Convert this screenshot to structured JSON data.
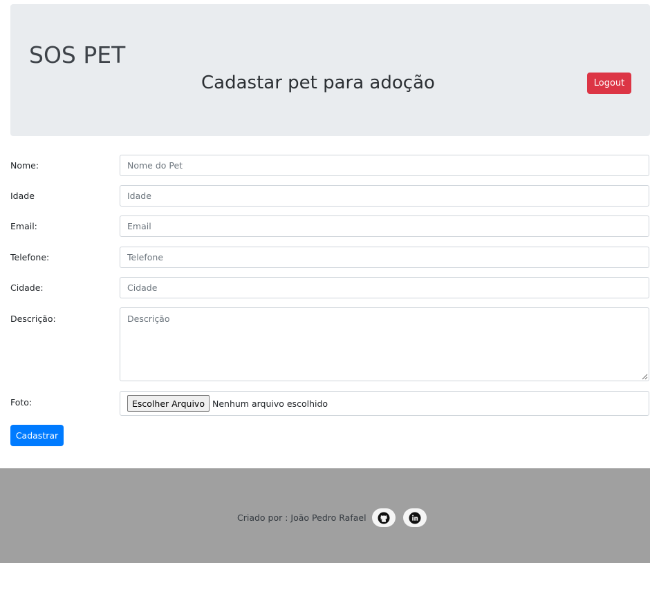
{
  "header": {
    "brand": "SOS PET",
    "title": "Cadastar pet para adoção",
    "logout_label": "Logout"
  },
  "form": {
    "fields": [
      {
        "label": "Nome:",
        "placeholder": "Nome do Pet",
        "value": ""
      },
      {
        "label": "Idade",
        "placeholder": "Idade",
        "value": ""
      },
      {
        "label": "Email:",
        "placeholder": "Email",
        "value": ""
      },
      {
        "label": "Telefone:",
        "placeholder": "Telefone",
        "value": ""
      },
      {
        "label": "Cidade:",
        "placeholder": "Cidade",
        "value": ""
      },
      {
        "label": "Descrição:",
        "placeholder": "Descrição",
        "value": ""
      }
    ],
    "photo": {
      "label": "Foto:",
      "button_label": "Escolher Arquivo",
      "status": "Nenhum arquivo escolhido"
    },
    "submit_label": "Cadastrar"
  },
  "footer": {
    "credit": "Criado por : João Pedro Rafael",
    "links": [
      {
        "icon": "github-icon"
      },
      {
        "icon": "linkedin-icon"
      }
    ]
  },
  "colors": {
    "header_bg": "#e9ecef",
    "danger": "#dc3545",
    "primary": "#007bff",
    "footer_bg": "#a0a0a0"
  }
}
